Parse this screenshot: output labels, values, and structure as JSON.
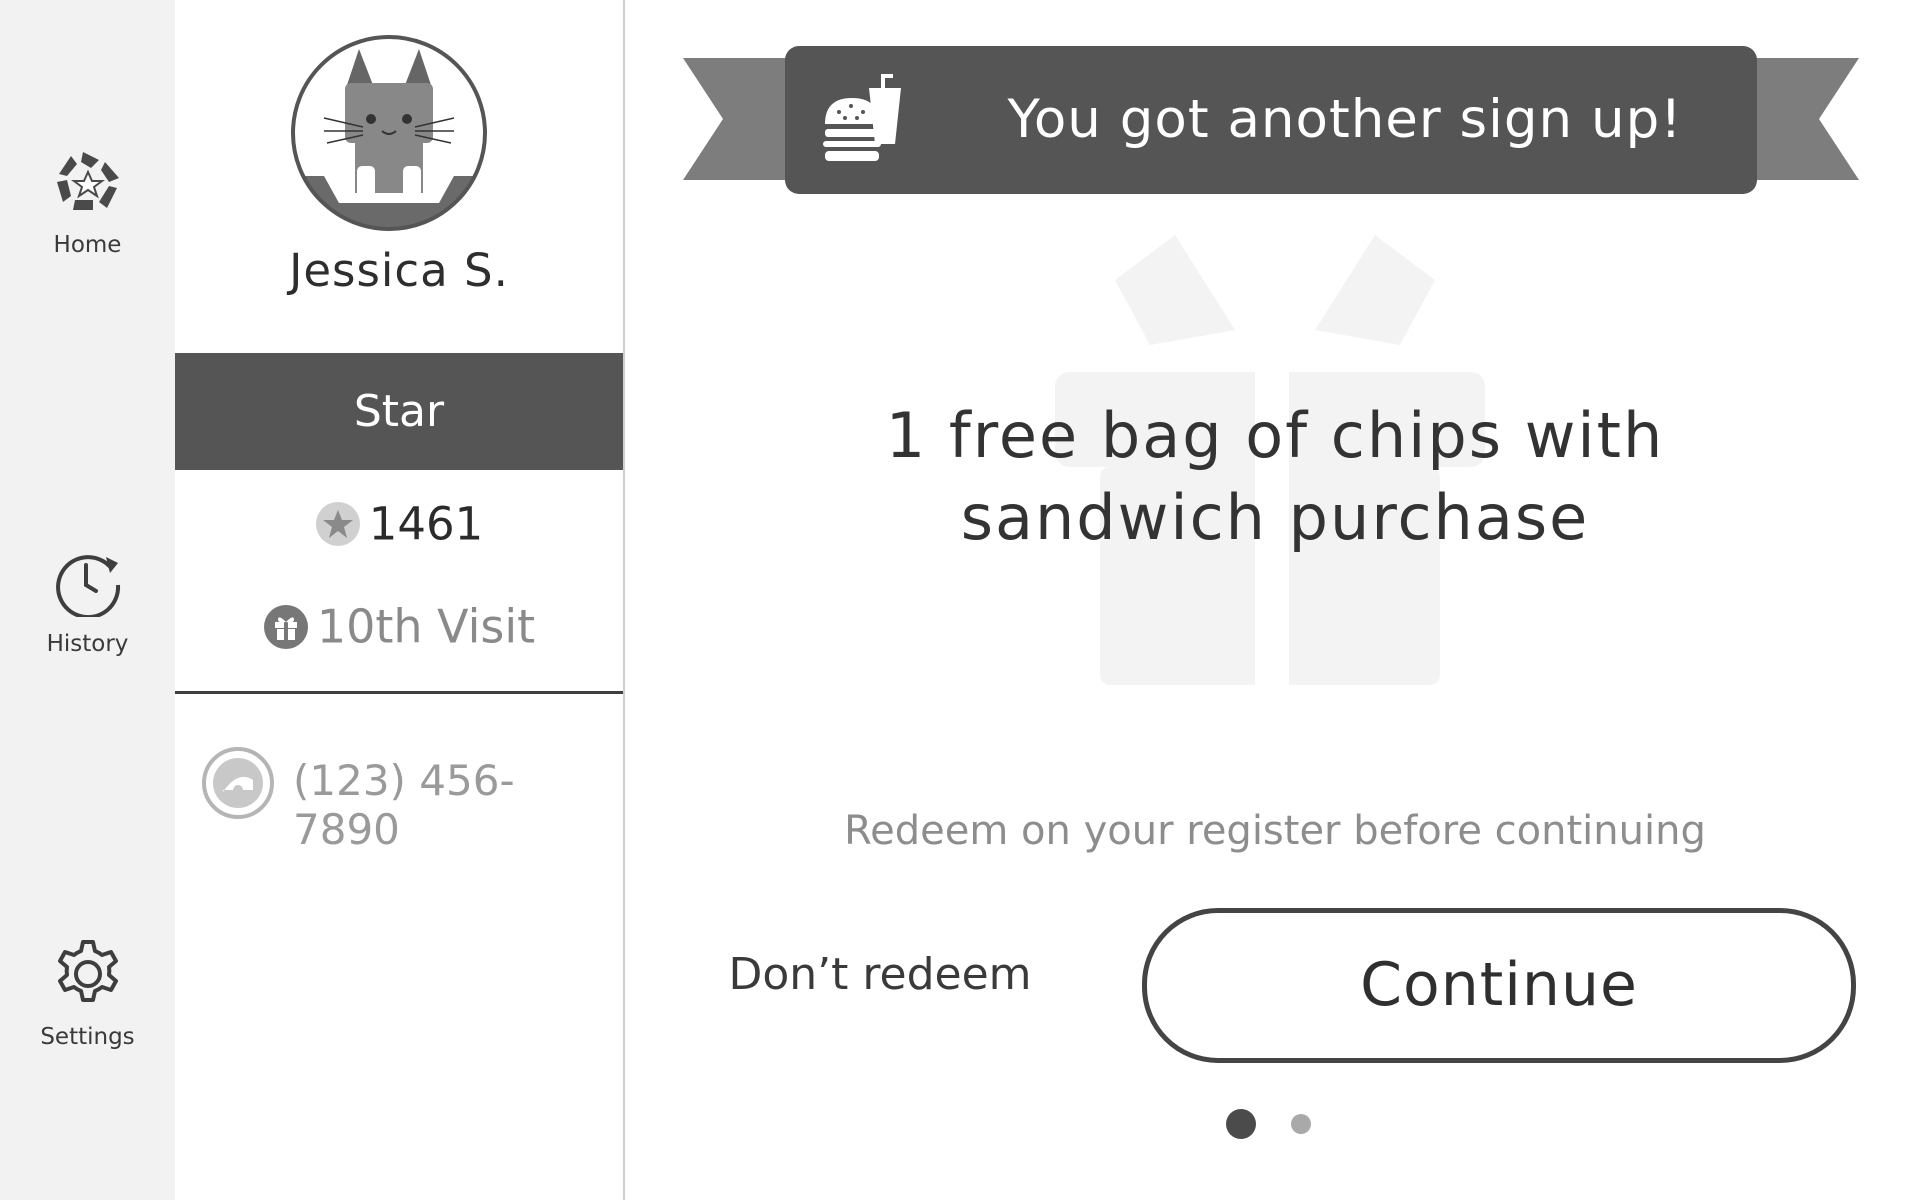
{
  "nav": {
    "items": [
      {
        "label": "Home",
        "icon": "star-arrows-icon"
      },
      {
        "label": "History",
        "icon": "history-clock-icon"
      },
      {
        "label": "Settings",
        "icon": "gear-icon"
      }
    ]
  },
  "customer": {
    "name": "Jessica S.",
    "avatar": "cat-avatar",
    "tier": "Star",
    "points": "1461",
    "points_icon": "star-badge-icon",
    "next_reward": "10th Visit",
    "next_reward_icon": "gift-icon",
    "phone": "(123) 456-7890",
    "phone_icon": "card-icon"
  },
  "banner": {
    "text": "You got another sign up!",
    "icon": "burger-drink-icon"
  },
  "reward": {
    "title_line1": "1 free bag of chips with",
    "title_line2": "sandwich purchase",
    "background_icon": "gift-box-icon"
  },
  "instructions": "Redeem on your register before continuing",
  "actions": {
    "dont_redeem": "Don’t redeem",
    "continue": "Continue"
  },
  "pagination": {
    "current": 1,
    "total": 2
  },
  "colors": {
    "banner": "#555555",
    "tier_bar": "#555555",
    "rail": "#f2f2f2"
  }
}
